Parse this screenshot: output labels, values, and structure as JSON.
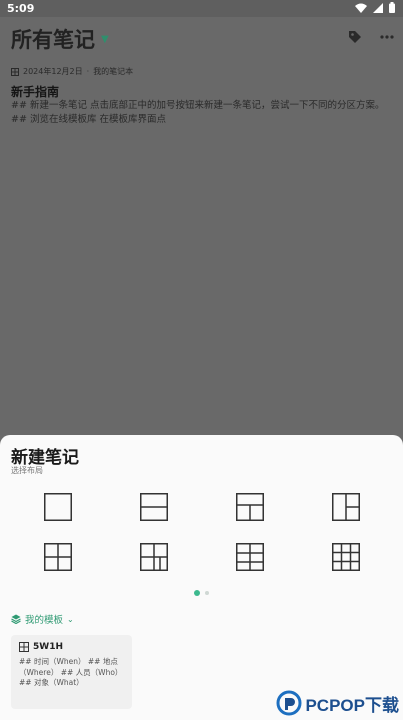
{
  "status_bar": {
    "time": "5:09",
    "icons": [
      "wifi-icon",
      "signal-icon",
      "battery-icon"
    ]
  },
  "header": {
    "title": "所有笔记",
    "icons": [
      "tag-icon",
      "more-icon"
    ]
  },
  "note": {
    "date": "2024年12月2日",
    "separator": "·",
    "notebook": "我的笔记本",
    "title": "新手指南",
    "body": "## 新建一条笔记 点击底部正中的加号按钮来新建一条笔记，尝试一下不同的分区方案。 ## 浏览在线模板库 在模板库界面点"
  },
  "sheet": {
    "title": "新建笔记",
    "subtitle": "选择布局",
    "layouts": [
      "layout-single",
      "layout-top-bottom",
      "layout-top-two-bottom",
      "layout-left-right-split",
      "layout-2x2",
      "layout-2x2-plus",
      "layout-3x2",
      "layout-3x3"
    ],
    "page": {
      "current": 1,
      "total": 2
    },
    "my_templates_label": "我的模板",
    "template_card": {
      "title": "5W1H",
      "body": "## 时间（When） ## 地点（Where） ## 人员（Who） ## 对象（What）"
    }
  },
  "watermark": "PCPOP下载",
  "colors": {
    "accent": "#3cb98e",
    "dim_overlay": "#696969",
    "sheet": "#fafafa"
  }
}
